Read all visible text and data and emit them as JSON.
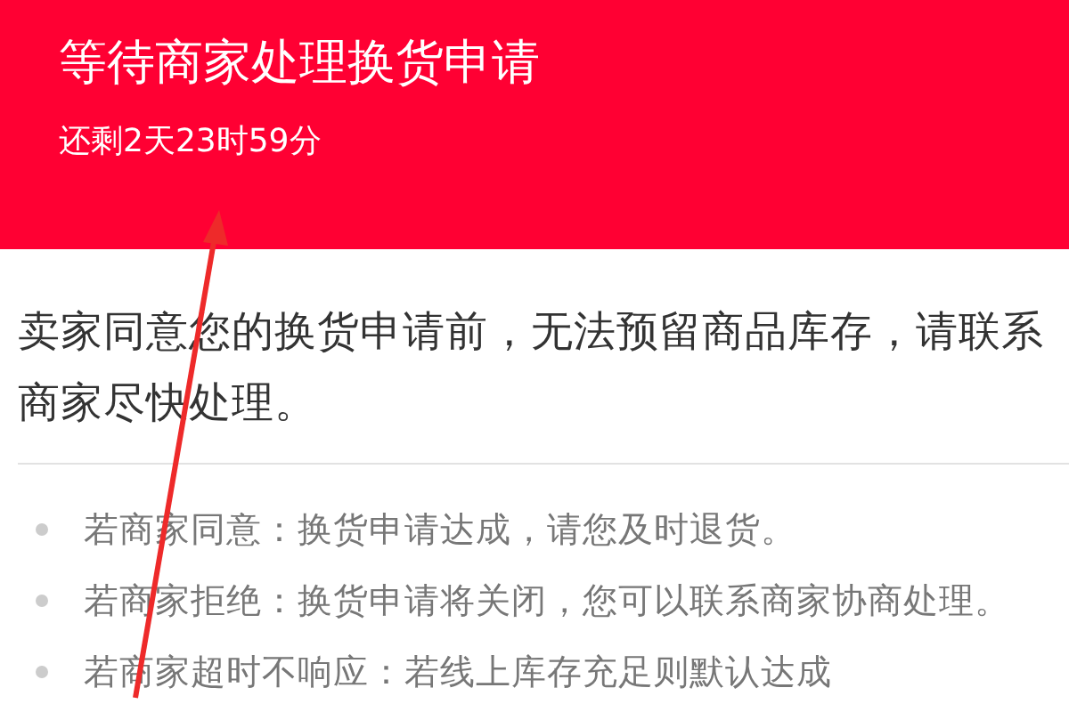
{
  "header": {
    "title": "等待商家处理换货申请",
    "countdown": "还剩2天23时59分"
  },
  "notice": "卖家同意您的换货申请前，无法预留商品库存，请联系商家尽快处理。",
  "rules": [
    "若商家同意：换货申请达成，请您及时退货。",
    "若商家拒绝：换货申请将关闭，您可以联系商家协商处理。",
    "若商家超时不响应：若线上库存充足则默认达成"
  ]
}
